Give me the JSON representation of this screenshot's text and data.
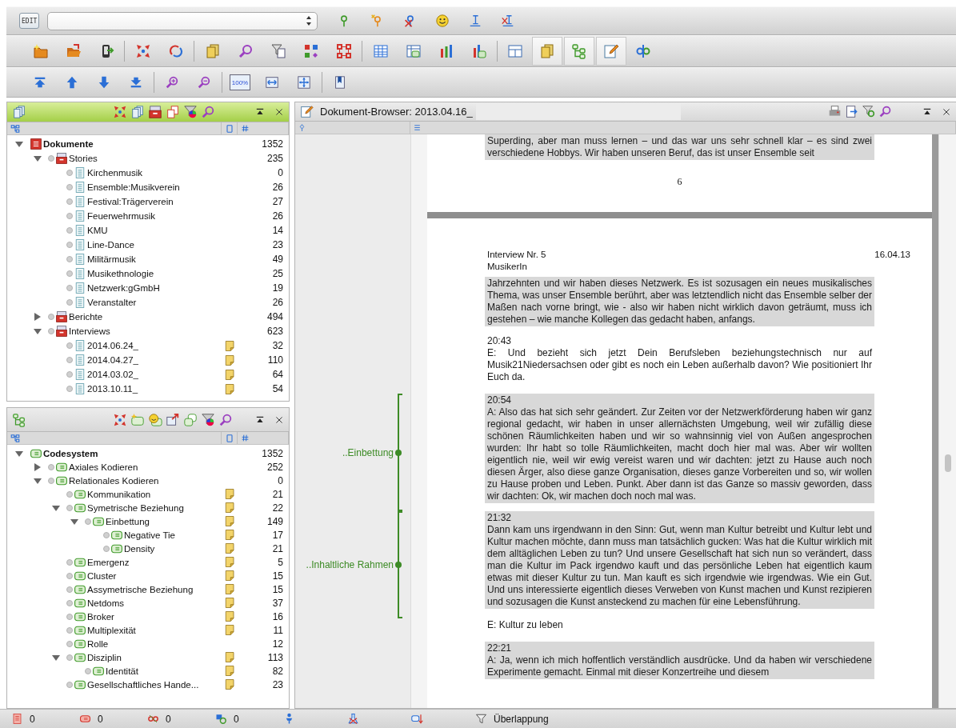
{
  "toolbar": {
    "mode_badge": "EDIT",
    "zoom_reset": "100%",
    "window_toggles": [
      {
        "on": false
      },
      {
        "on": true
      },
      {
        "on": true
      },
      {
        "on": true
      },
      {
        "on": false
      }
    ]
  },
  "documents_panel": {
    "active": true,
    "items": [
      {
        "label": "Dokumente",
        "count": "1352",
        "kind": "document-root",
        "expanded": true,
        "children": [
          {
            "label": "Stories",
            "count": "235",
            "kind": "document-set",
            "expanded": true,
            "activated": false,
            "memo": false,
            "children": [
              {
                "label": "Kirchenmusik",
                "count": "0",
                "kind": "document",
                "activated": false,
                "memo": false
              },
              {
                "label": "Ensemble:Musikverein",
                "count": "26",
                "kind": "document",
                "activated": false,
                "memo": false
              },
              {
                "label": "Festival:Trägerverein",
                "count": "27",
                "kind": "document",
                "activated": false,
                "memo": false
              },
              {
                "label": "Feuerwehrmusik",
                "count": "26",
                "kind": "document",
                "activated": false,
                "memo": false
              },
              {
                "label": "KMU",
                "count": "14",
                "kind": "document",
                "activated": false,
                "memo": false
              },
              {
                "label": "Line-Dance",
                "count": "23",
                "kind": "document",
                "activated": false,
                "memo": false
              },
              {
                "label": "Militärmusik",
                "count": "49",
                "kind": "document",
                "activated": false,
                "memo": false
              },
              {
                "label": "Musikethnologie",
                "count": "25",
                "kind": "document",
                "activated": false,
                "memo": false
              },
              {
                "label": "Netzwerk:gGmbH",
                "count": "19",
                "kind": "document",
                "activated": false,
                "memo": false
              },
              {
                "label": "Veranstalter",
                "count": "26",
                "kind": "document",
                "activated": false,
                "memo": false
              }
            ]
          },
          {
            "label": "Berichte",
            "count": "494",
            "kind": "document-set",
            "expanded": false,
            "activated": false,
            "memo": false
          },
          {
            "label": "Interviews",
            "count": "623",
            "kind": "document-set",
            "expanded": true,
            "activated": false,
            "memo": false,
            "children": [
              {
                "label": "2014.06.24_",
                "count": "32",
                "kind": "document",
                "activated": false,
                "memo": true
              },
              {
                "label": "2014.04.27_",
                "count": "110",
                "kind": "document",
                "activated": false,
                "memo": true
              },
              {
                "label": "2014.03.02_",
                "count": "64",
                "kind": "document",
                "activated": false,
                "memo": true
              },
              {
                "label": "2013.10.11_",
                "count": "54",
                "kind": "document",
                "activated": false,
                "memo": true
              }
            ]
          }
        ]
      }
    ]
  },
  "codes_panel": {
    "active": false,
    "items": [
      {
        "label": "Codesystem",
        "count": "1352",
        "kind": "code-root",
        "expanded": true,
        "children": [
          {
            "label": "Axiales Kodieren",
            "count": "252",
            "kind": "code",
            "expanded": false,
            "activated": false,
            "memo": false
          },
          {
            "label": "Relationales Kodieren",
            "count": "0",
            "kind": "code",
            "expanded": true,
            "activated": false,
            "memo": false,
            "children": [
              {
                "label": "Kommunikation",
                "count": "21",
                "kind": "code",
                "activated": false,
                "memo": true
              },
              {
                "label": "Symetrische Beziehung",
                "count": "22",
                "kind": "code",
                "expanded": true,
                "activated": false,
                "memo": true,
                "children": [
                  {
                    "label": "Einbettung",
                    "count": "149",
                    "kind": "code",
                    "expanded": true,
                    "activated": false,
                    "memo": true,
                    "children": [
                      {
                        "label": "Negative Tie",
                        "count": "17",
                        "kind": "code",
                        "activated": false,
                        "memo": true
                      },
                      {
                        "label": "Density",
                        "count": "21",
                        "kind": "code",
                        "activated": false,
                        "memo": true
                      }
                    ]
                  }
                ]
              },
              {
                "label": "Emergenz",
                "count": "5",
                "kind": "code",
                "activated": false,
                "memo": true
              },
              {
                "label": "Cluster",
                "count": "15",
                "kind": "code",
                "activated": false,
                "memo": true
              },
              {
                "label": "Assymetrische Beziehung",
                "count": "15",
                "kind": "code",
                "activated": false,
                "memo": true
              },
              {
                "label": "Netdoms",
                "count": "37",
                "kind": "code",
                "activated": false,
                "memo": true
              },
              {
                "label": "Broker",
                "count": "16",
                "kind": "code",
                "activated": false,
                "memo": true
              },
              {
                "label": "Multiplexität",
                "count": "11",
                "kind": "code",
                "activated": false,
                "memo": true
              },
              {
                "label": "Rolle",
                "count": "12",
                "kind": "code",
                "activated": false,
                "memo": false
              },
              {
                "label": "Disziplin",
                "count": "113",
                "kind": "code",
                "expanded": true,
                "activated": false,
                "memo": true,
                "children": [
                  {
                    "label": "Identität",
                    "count": "82",
                    "kind": "code",
                    "activated": false,
                    "memo": true
                  }
                ]
              },
              {
                "label": "Gesellschaftliches Hande...",
                "count": "23",
                "kind": "code",
                "activated": false,
                "memo": true
              }
            ]
          }
        ]
      }
    ]
  },
  "document_browser": {
    "active": false,
    "title": "Dokument-Browser: 2013.04.16_",
    "pages": [
      {
        "blocks": [
          {
            "text": "Superding, aber man muss lernen – und das war uns sehr schnell klar – es sind zwei verschiedene Hobbys. Wir haben unseren Beruf, das ist unser Ensemble seit",
            "highlighted": true
          }
        ],
        "page_number": "6"
      },
      {
        "header": {
          "lines": [
            "Interview Nr. 5",
            "MusikerIn"
          ],
          "date": "16.04.13"
        },
        "blocks": [
          {
            "text": "Jahrzehnten und wir haben dieses Netzwerk. Es ist sozusagen ein neues musikalisches Thema, was unser Ensemble berührt, aber was letztendlich nicht das Ensemble selber der Maßen nach vorne bringt, wie - also wir haben nicht wirklich davon geträumt, muss ich gestehen – wie manche Kollegen das gedacht haben, anfangs.",
            "highlighted": true
          },
          {
            "time": "20:43",
            "text": "E: Und bezieht sich jetzt Dein Berufsleben beziehungstechnisch nur auf Musik21Niedersachsen oder gibt es noch ein Leben außerhalb davon? Wie positioniert Ihr Euch da.",
            "highlighted": false
          },
          {
            "time": "20:54",
            "text": "A: Also das hat sich sehr geändert. Zur Zeiten vor der Netzwerkförderung haben wir ganz regional gedacht, wir haben in unser allernächsten Umgebung, weil wir zufällig diese schönen Räumlichkeiten haben und wir so wahnsinnig viel von Außen angesprochen wurden: Ihr habt so tolle Räumlichkeiten, macht doch hier mal was. Aber wir wollten eigentlich nie, weil wir ewig vereist waren und wir dachten: jetzt zu Hause auch noch diesen Ärger, also diese ganze Organisation, dieses ganze Vorbereiten und so, wir wollen zu Hause proben und Leben. Punkt. Aber dann ist das Ganze so massiv geworden, dass wir dachten: Ok, wir machen doch noch mal was.",
            "highlighted": true,
            "coding": "..Einbettung"
          },
          {
            "time": "21:32",
            "text": "Dann kam uns irgendwann in den Sinn: Gut, wenn man Kultur betreibt und Kultur lebt und Kultur machen möchte, dann muss man tatsächlich gucken: Was hat die Kultur wirklich mit dem alltäglichen Leben zu tun? Und unsere Gesellschaft hat sich nun so verändert, dass man die Kultur im Pack irgendwo kauft und das persönliche Leben hat eigentlich kaum etwas mit dieser Kultur zu tun. Man kauft es sich irgendwie wie irgendwas. Wie ein Gut. Und uns interessierte eigentlich dieses Verweben von Kunst machen und Kunst rezipieren und sozusagen die Kunst ansteckend zu machen für eine Lebensführung.",
            "highlighted": true,
            "coding": "..Inhaltliche Rahmen"
          },
          {
            "text": "E: Kultur zu leben",
            "highlighted": false
          },
          {
            "time": "22:21",
            "text": "A: Ja, wenn ich mich hoffentlich verständlich ausdrücke. Und da haben wir verschiedene Experimente gemacht. Einmal mit dieser Konzertreihe und diesem",
            "highlighted": true
          }
        ]
      }
    ]
  },
  "status_bar": [
    {
      "kind": "documents",
      "count": "0"
    },
    {
      "kind": "codes",
      "count": "0"
    },
    {
      "kind": "links",
      "count": "0"
    },
    {
      "kind": "sets",
      "count": "0"
    },
    {
      "kind": "person"
    },
    {
      "kind": "flask"
    },
    {
      "kind": "tag-down"
    },
    {
      "kind": "filter",
      "label": "Überlappung"
    }
  ]
}
